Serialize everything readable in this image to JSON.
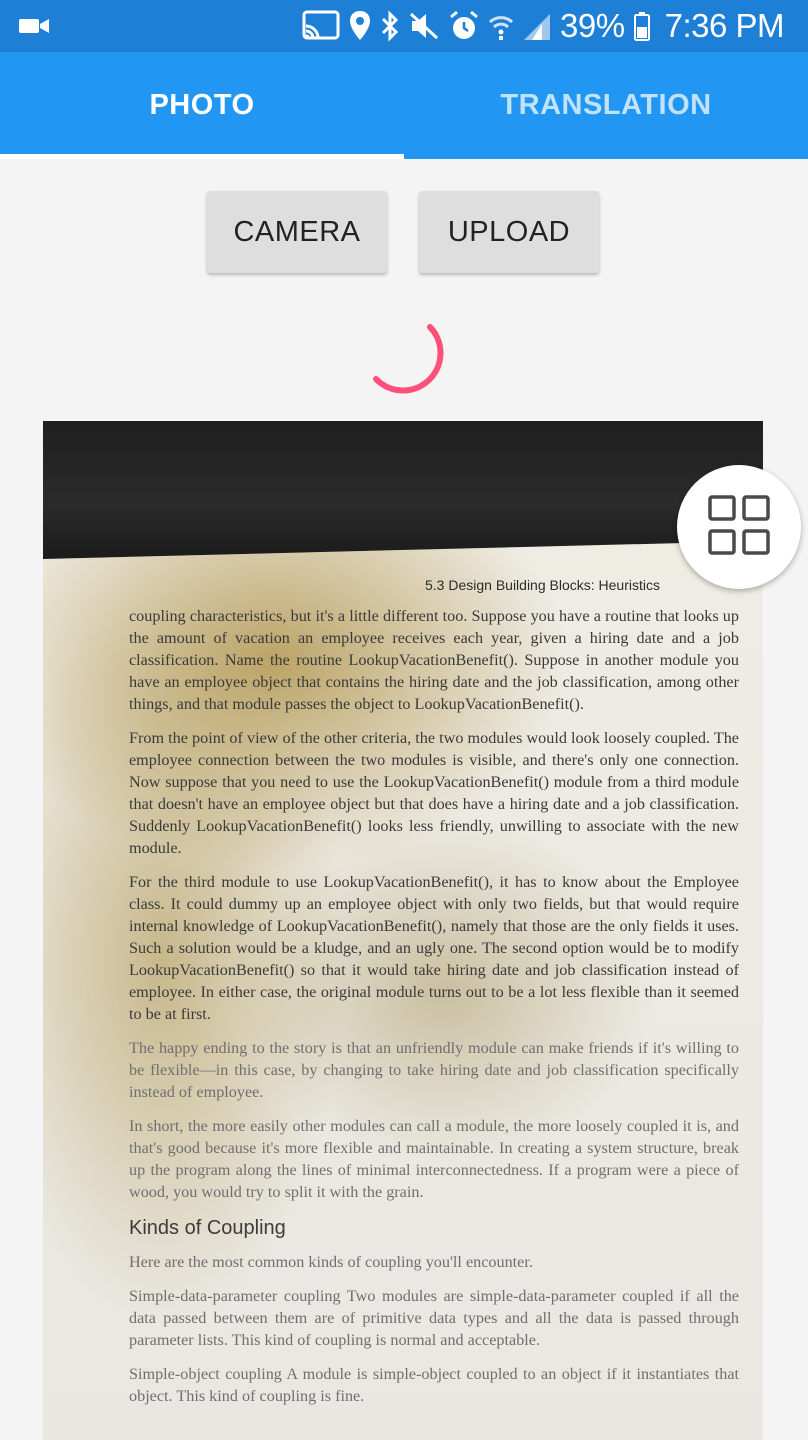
{
  "status_bar": {
    "battery": "39%",
    "time": "7:36 PM",
    "icons": [
      "video-camera-icon",
      "cast-icon",
      "location-icon",
      "bluetooth-icon",
      "mute-icon",
      "alarm-icon",
      "wifi-icon",
      "signal-icon",
      "battery-icon"
    ]
  },
  "tabs": [
    {
      "label": "PHOTO",
      "active": true
    },
    {
      "label": "TRANSLATION",
      "active": false
    }
  ],
  "buttons": {
    "camera": "CAMERA",
    "upload": "UPLOAD"
  },
  "photo": {
    "header": "5.3 Design Building Blocks: Heuristics",
    "paragraphs": [
      "coupling characteristics, but it's a little different too. Suppose you have a routine that looks up the amount of vacation an employee receives each year, given a hiring date and a job classification. Name the routine LookupVacationBenefit(). Suppose in another module you have an employee object that contains the hiring date and the job classification, among other things, and that module passes the object to LookupVacationBenefit().",
      "From the point of view of the other criteria, the two modules would look loosely coupled. The employee connection between the two modules is visible, and there's only one connection. Now suppose that you need to use the LookupVacationBenefit() module from a third module that doesn't have an employee object but that does have a hiring date and a job classification. Suddenly LookupVacationBenefit() looks less friendly, unwilling to associate with the new module.",
      "For the third module to use LookupVacationBenefit(), it has to know about the Employee class. It could dummy up an employee object with only two fields, but that would require internal knowledge of LookupVacationBenefit(), namely that those are the only fields it uses. Such a solution would be a kludge, and an ugly one. The second option would be to modify LookupVacationBenefit() so that it would take hiring date and job classification instead of employee. In either case, the original module turns out to be a lot less flexible than it seemed to be at first.",
      "The happy ending to the story is that an unfriendly module can make friends if it's willing to be flexible—in this case, by changing to take hiring date and job classification specifically instead of employee.",
      "In short, the more easily other modules can call a module, the more loosely coupled it is, and that's good because it's more flexible and maintainable. In creating a system structure, break up the program along the lines of minimal interconnectedness. If a program were a piece of wood, you would try to split it with the grain."
    ],
    "heading": "Kinds of Coupling",
    "paragraphs_after": [
      "Here are the most common kinds of coupling you'll encounter.",
      "Simple-data-parameter coupling   Two modules are simple-data-parameter coupled if all the data passed between them are of primitive data types and all the data is passed through parameter lists. This kind of coupling is normal and acceptable.",
      "Simple-object coupling   A module is simple-object coupled to an object if it instantiates that object. This kind of coupling is fine."
    ]
  },
  "colors": {
    "status_bar": "#1e7fd6",
    "tab_bar": "#2196f3",
    "spinner": "#ff4f7b"
  }
}
